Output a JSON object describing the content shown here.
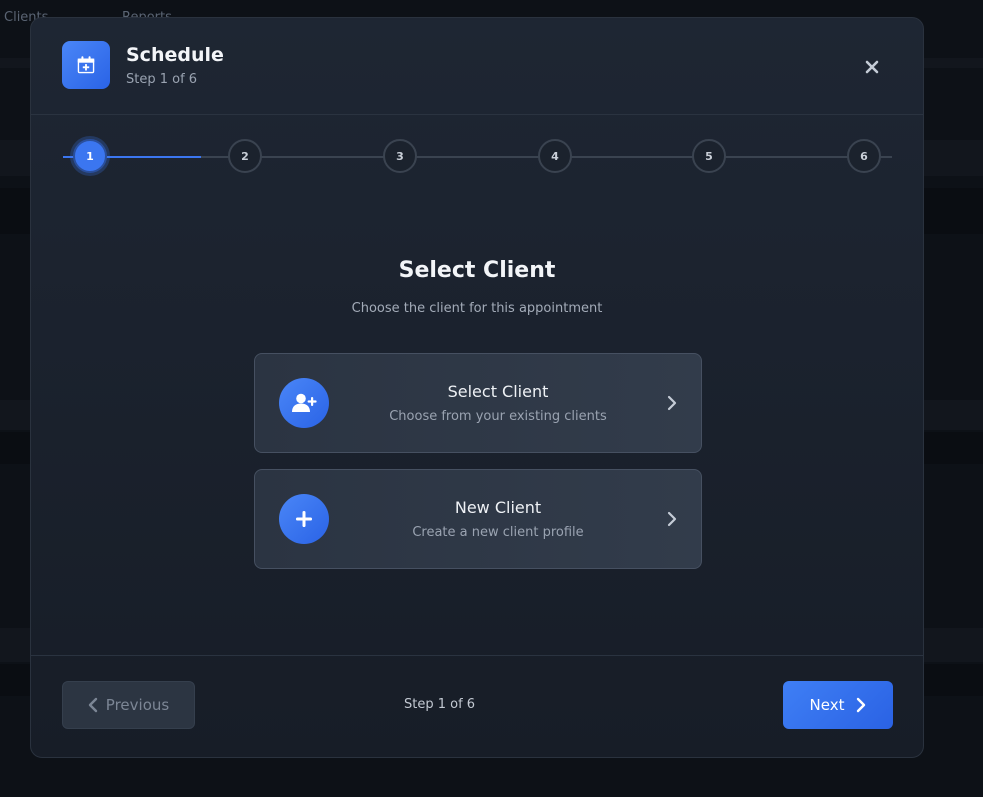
{
  "background": {
    "top_left_text": "Clients",
    "top_text_2": "Reports"
  },
  "modal": {
    "title": "Schedule",
    "subtitle": "Step 1 of 6",
    "icon": "calendar-plus-icon",
    "close_icon": "close-icon"
  },
  "stepper": {
    "steps": [
      "1",
      "2",
      "3",
      "4",
      "5",
      "6"
    ],
    "current": 1
  },
  "content": {
    "title": "Select Client",
    "subtitle": "Choose the client for this appointment",
    "options": [
      {
        "title": "Select Client",
        "description": "Choose from your existing clients",
        "icon": "user-plus-icon"
      },
      {
        "title": "New Client",
        "description": "Create a new client profile",
        "icon": "plus-icon"
      }
    ]
  },
  "footer": {
    "previous_label": "Previous",
    "step_text": "Step 1 of 6",
    "next_label": "Next"
  },
  "colors": {
    "accent": "#3b76f0",
    "modal_bg": "#1e2633",
    "card_bg": "#2b3442"
  }
}
